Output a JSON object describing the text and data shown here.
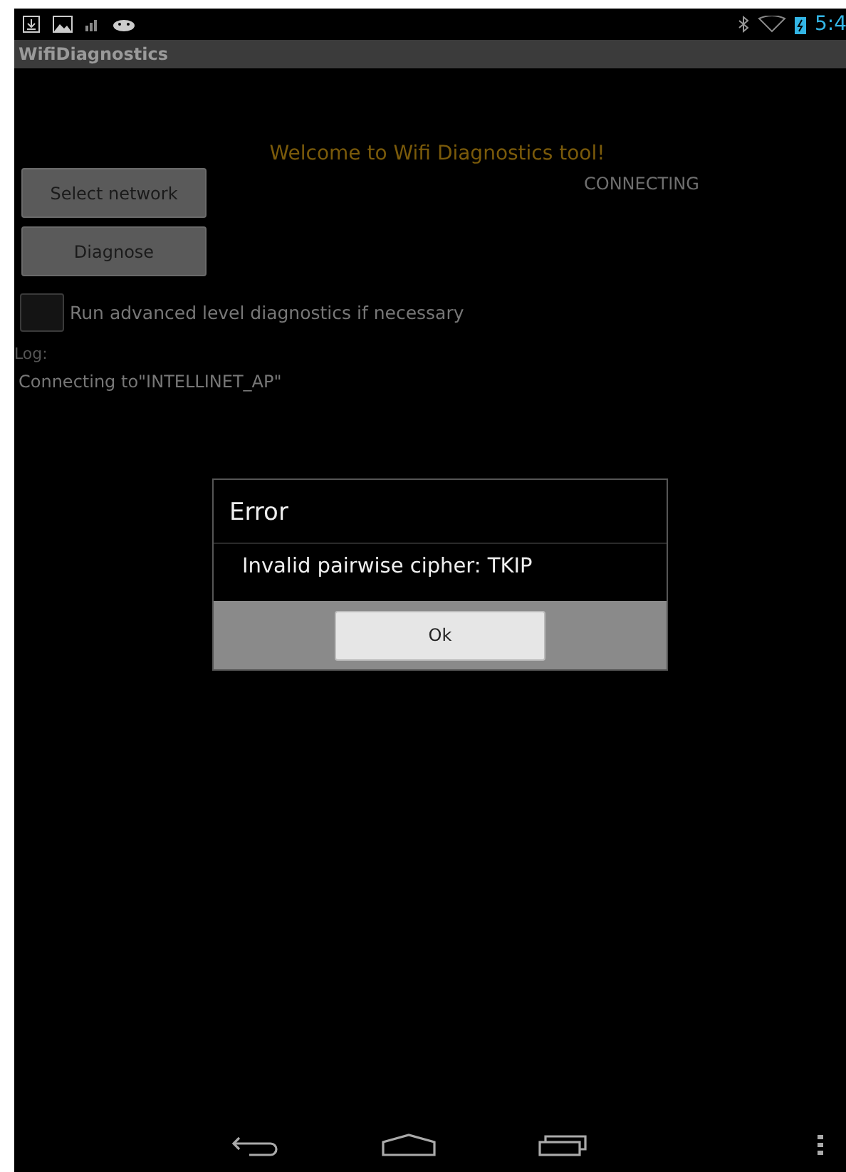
{
  "status_bar": {
    "time": "5:4"
  },
  "app_bar": {
    "title": "WifiDiagnostics"
  },
  "welcome": "Welcome to Wifi Diagnostics tool!",
  "buttons": [
    {
      "label": "Select network"
    },
    {
      "label": "Diagnose"
    }
  ],
  "connection_state": "CONNECTING",
  "advanced_option": {
    "label": "Run advanced level diagnostics if necessary",
    "checked": false
  },
  "log": {
    "label": "Log:",
    "lines": [
      "Connecting to\"INTELLINET_AP\""
    ]
  },
  "dialog": {
    "title": "Error",
    "message": "Invalid pairwise cipher: TKIP",
    "button": "Ok"
  }
}
